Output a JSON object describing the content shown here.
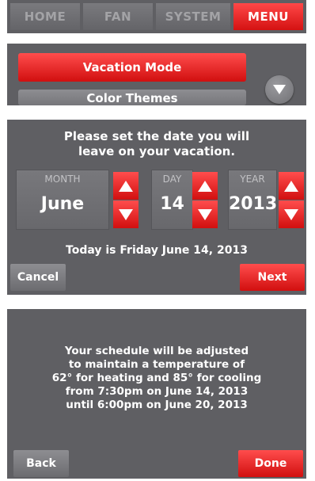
{
  "nav": {
    "items": [
      {
        "label": "HOME"
      },
      {
        "label": "FAN"
      },
      {
        "label": "SYSTEM"
      },
      {
        "label": "MENU"
      }
    ],
    "active": "MENU"
  },
  "menu": {
    "selected_label": "Vacation Mode",
    "next_label": "Color Themes",
    "scroll_icon": "chevron-down-icon"
  },
  "date_picker": {
    "prompt": "Please set the date you will\nleave on your vacation.",
    "month": {
      "label": "MONTH",
      "value": "June"
    },
    "day": {
      "label": "DAY",
      "value": "14"
    },
    "year": {
      "label": "YEAR",
      "value": "2013"
    },
    "today": "Today is Friday June 14, 2013",
    "cancel_label": "Cancel",
    "next_label": "Next"
  },
  "summary": {
    "text": "Your schedule will be adjusted\nto maintain a temperature of\n62° for heating and 85° for cooling\nfrom 7:30pm on June 14, 2013\nuntil 6:00pm on June 20, 2013",
    "back_label": "Back",
    "done_label": "Done"
  },
  "colors": {
    "panel": "#5f5f63",
    "accent_red": "#e41c1c",
    "text": "#ffffff"
  }
}
